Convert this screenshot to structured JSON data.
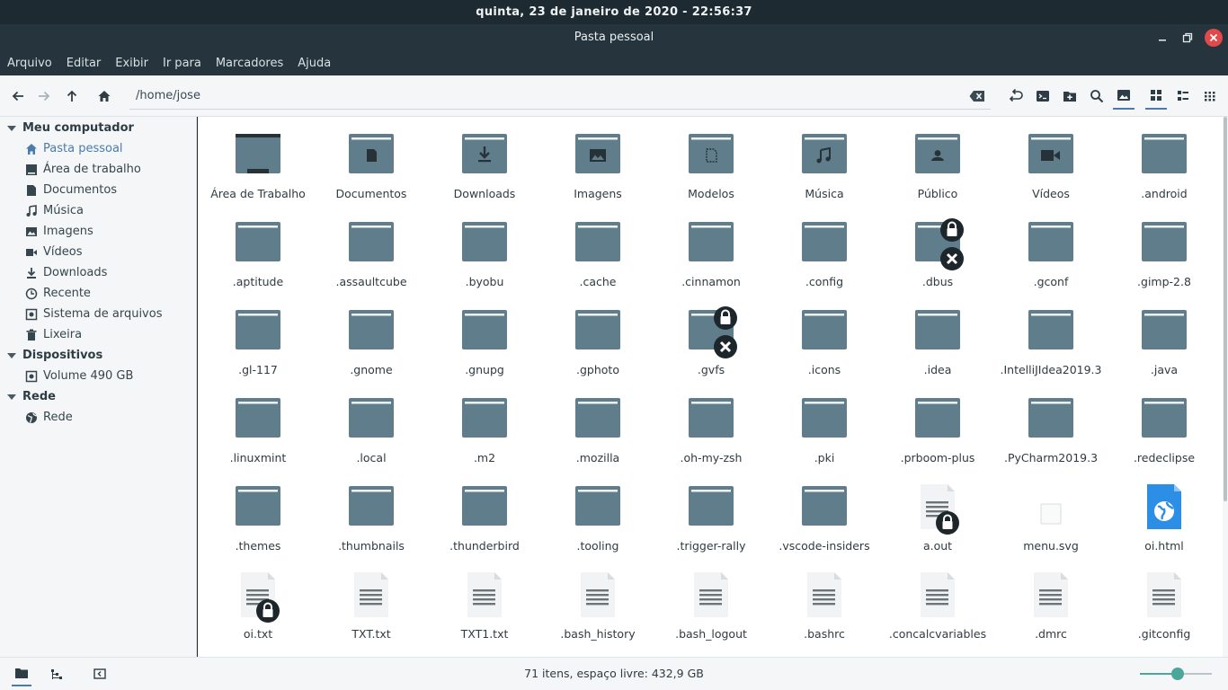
{
  "clock": "quinta, 23 de janeiro de 2020 - 22:56:37",
  "window": {
    "title": "Pasta pessoal"
  },
  "menu": [
    "Arquivo",
    "Editar",
    "Exibir",
    "Ir para",
    "Marcadores",
    "Ajuda"
  ],
  "toolbar": {
    "path": "/home/jose"
  },
  "sidebar": {
    "sections": [
      {
        "title": "Meu computador",
        "items": [
          {
            "label": "Pasta pessoal",
            "icon": "home-icon",
            "active": true
          },
          {
            "label": "Área de trabalho",
            "icon": "desktop-icon"
          },
          {
            "label": "Documentos",
            "icon": "document-icon"
          },
          {
            "label": "Música",
            "icon": "music-icon"
          },
          {
            "label": "Imagens",
            "icon": "image-icon"
          },
          {
            "label": "Vídeos",
            "icon": "video-icon"
          },
          {
            "label": "Downloads",
            "icon": "download-icon"
          },
          {
            "label": "Recente",
            "icon": "clock-icon"
          },
          {
            "label": "Sistema de arquivos",
            "icon": "drive-icon"
          },
          {
            "label": "Lixeira",
            "icon": "trash-icon"
          }
        ]
      },
      {
        "title": "Dispositivos",
        "items": [
          {
            "label": "Volume 490 GB",
            "icon": "drive-icon"
          }
        ]
      },
      {
        "title": "Rede",
        "items": [
          {
            "label": "Rede",
            "icon": "network-icon"
          }
        ]
      }
    ]
  },
  "files": [
    {
      "name": "Área de Trabalho",
      "type": "desktop"
    },
    {
      "name": "Documentos",
      "type": "folder-documents"
    },
    {
      "name": "Downloads",
      "type": "folder-downloads"
    },
    {
      "name": "Imagens",
      "type": "folder-pictures"
    },
    {
      "name": "Modelos",
      "type": "folder-templates"
    },
    {
      "name": "Música",
      "type": "folder-music"
    },
    {
      "name": "Público",
      "type": "folder-public"
    },
    {
      "name": "Vídeos",
      "type": "folder-videos"
    },
    {
      "name": ".android",
      "type": "folder"
    },
    {
      "name": ".aptitude",
      "type": "folder"
    },
    {
      "name": ".assaultcube",
      "type": "folder"
    },
    {
      "name": ".byobu",
      "type": "folder"
    },
    {
      "name": ".cache",
      "type": "folder"
    },
    {
      "name": ".cinnamon",
      "type": "folder"
    },
    {
      "name": ".config",
      "type": "folder"
    },
    {
      "name": ".dbus",
      "type": "folder",
      "locked": true,
      "unreadable": true
    },
    {
      "name": ".gconf",
      "type": "folder"
    },
    {
      "name": ".gimp-2.8",
      "type": "folder"
    },
    {
      "name": ".gl-117",
      "type": "folder"
    },
    {
      "name": ".gnome",
      "type": "folder"
    },
    {
      "name": ".gnupg",
      "type": "folder"
    },
    {
      "name": ".gphoto",
      "type": "folder"
    },
    {
      "name": ".gvfs",
      "type": "folder",
      "locked": true,
      "unreadable": true
    },
    {
      "name": ".icons",
      "type": "folder"
    },
    {
      "name": ".idea",
      "type": "folder"
    },
    {
      "name": ".IntelliJIdea2019.3",
      "type": "folder"
    },
    {
      "name": ".java",
      "type": "folder"
    },
    {
      "name": ".linuxmint",
      "type": "folder"
    },
    {
      "name": ".local",
      "type": "folder"
    },
    {
      "name": ".m2",
      "type": "folder"
    },
    {
      "name": ".mozilla",
      "type": "folder"
    },
    {
      "name": ".oh-my-zsh",
      "type": "folder"
    },
    {
      "name": ".pki",
      "type": "folder"
    },
    {
      "name": ".prboom-plus",
      "type": "folder"
    },
    {
      "name": ".PyCharm2019.3",
      "type": "folder"
    },
    {
      "name": ".redeclipse",
      "type": "folder"
    },
    {
      "name": ".themes",
      "type": "folder"
    },
    {
      "name": ".thumbnails",
      "type": "folder"
    },
    {
      "name": ".thunderbird",
      "type": "folder"
    },
    {
      "name": ".tooling",
      "type": "folder"
    },
    {
      "name": ".trigger-rally",
      "type": "folder"
    },
    {
      "name": ".vscode-insiders",
      "type": "folder"
    },
    {
      "name": "a.out",
      "type": "text",
      "locked": true
    },
    {
      "name": "menu.svg",
      "type": "image-thumb"
    },
    {
      "name": "oi.html",
      "type": "html"
    },
    {
      "name": "oi.txt",
      "type": "text",
      "locked": true
    },
    {
      "name": "TXT.txt",
      "type": "text"
    },
    {
      "name": "TXT1.txt",
      "type": "text"
    },
    {
      "name": ".bash_history",
      "type": "text"
    },
    {
      "name": ".bash_logout",
      "type": "text"
    },
    {
      "name": ".bashrc",
      "type": "text"
    },
    {
      "name": ".concalcvariables",
      "type": "text"
    },
    {
      "name": ".dmrc",
      "type": "text"
    },
    {
      "name": ".gitconfig",
      "type": "text"
    }
  ],
  "status": {
    "text": "71 itens, espaço livre: 432,9 GB",
    "zoom_level": 0.52
  },
  "colors": {
    "folder": "#607d8b",
    "folder_tab": "#eef2f4",
    "accent": "#4aa79a",
    "close": "#e04a4a"
  }
}
